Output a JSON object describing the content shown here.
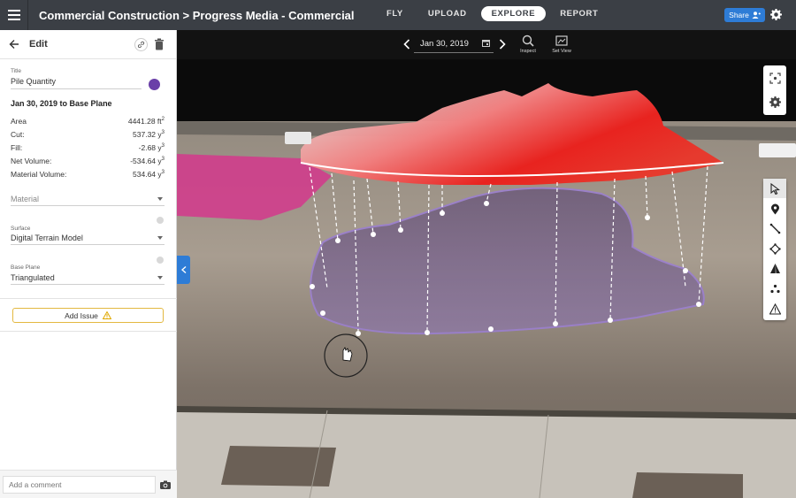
{
  "header": {
    "title": "Commercial Construction > Progress Media - Commercial",
    "nav_tabs": [
      {
        "label": "FLY",
        "active": false
      },
      {
        "label": "UPLOAD",
        "active": false
      },
      {
        "label": "EXPLORE",
        "active": true
      },
      {
        "label": "REPORT",
        "active": false
      }
    ],
    "share_label": "Share"
  },
  "sidebar": {
    "header_title": "Edit",
    "title_field": {
      "label": "Title",
      "value": "Pile Quantity",
      "color": "#6a3fa8"
    },
    "section_title": "Jan 30, 2019 to Base Plane",
    "stats": [
      {
        "label": "Area",
        "value": "4441.28 ft",
        "unit_sup": "2"
      },
      {
        "label": "Cut:",
        "value": "537.32 y",
        "unit_sup": "3"
      },
      {
        "label": "Fill:",
        "value": "-2.68 y",
        "unit_sup": "3"
      },
      {
        "label": "Net Volume:",
        "value": "-534.64 y",
        "unit_sup": "3"
      },
      {
        "label": "Material Volume:",
        "value": "534.64 y",
        "unit_sup": "3"
      }
    ],
    "material": {
      "placeholder": "Material"
    },
    "surface": {
      "label": "Surface",
      "value": "Digital Terrain Model"
    },
    "base_plane": {
      "label": "Base Plane",
      "value": "Triangulated"
    },
    "add_issue_label": "Add Issue",
    "comment_placeholder": "Add a comment"
  },
  "viewport": {
    "date": "Jan 30, 2019",
    "tools": [
      {
        "label": "Inspect",
        "icon": "magnifier-icon"
      },
      {
        "label": "Set View",
        "icon": "frame-icon"
      }
    ],
    "right_tools": [
      "select-arrow-icon",
      "location-pin-icon",
      "measure-line-icon",
      "area-polygon-icon",
      "volume-cone-icon",
      "count-dots-icon",
      "warning-triangle-icon"
    ]
  }
}
